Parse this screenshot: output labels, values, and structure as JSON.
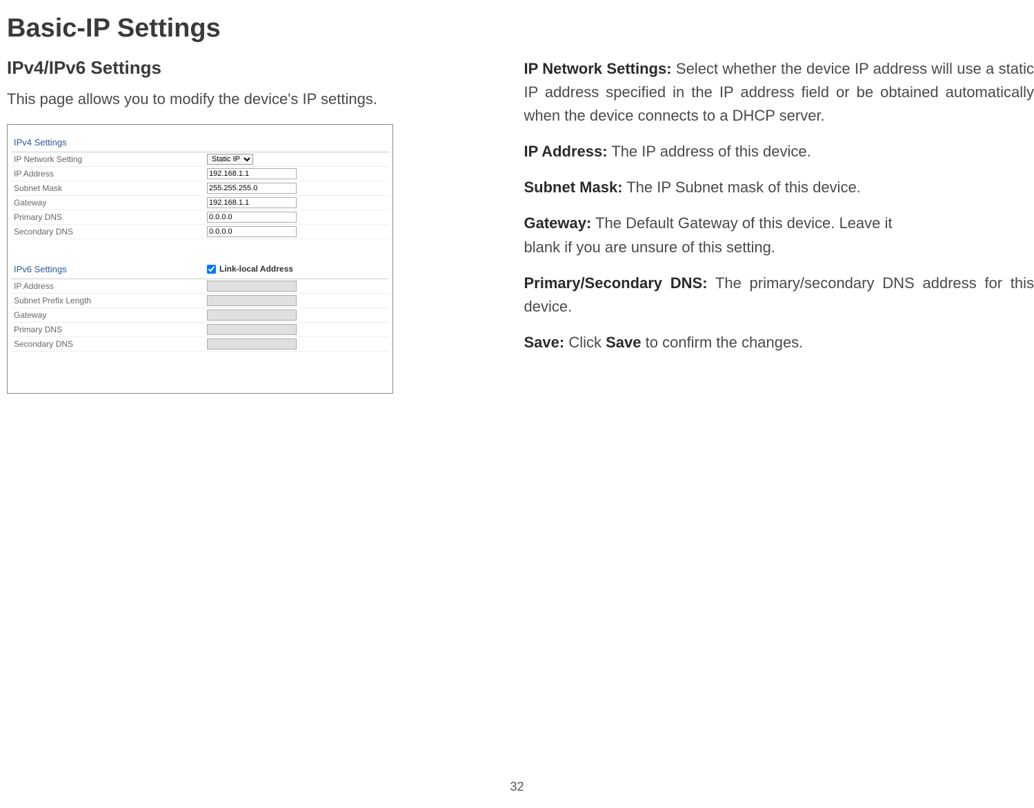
{
  "page_title": "Basic-IP Settings",
  "section_title": "IPv4/IPv6 Settings",
  "intro_text": "This page allows you to modify the device's IP settings.",
  "ipv4": {
    "header": "IPv4 Settings",
    "rows": {
      "ip_network_setting_label": "IP Network Setting",
      "ip_network_setting_value": "Static IP",
      "ip_address_label": "IP Address",
      "ip_address_value": "192.168.1.1",
      "subnet_mask_label": "Subnet Mask",
      "subnet_mask_value": "255.255.255.0",
      "gateway_label": "Gateway",
      "gateway_value": "192.168.1.1",
      "primary_dns_label": "Primary DNS",
      "primary_dns_value": "0.0.0.0",
      "secondary_dns_label": "Secondary DNS",
      "secondary_dns_value": "0.0.0.0"
    }
  },
  "ipv6": {
    "header": "IPv6 Settings",
    "link_local_label": "Link-local Address",
    "rows": {
      "ip_address_label": "IP Address",
      "subnet_prefix_label": "Subnet Prefix Length",
      "gateway_label": "Gateway",
      "primary_dns_label": "Primary DNS",
      "secondary_dns_label": "Secondary DNS"
    }
  },
  "descriptions": {
    "ip_network_bold": "IP Network Settings:",
    "ip_network_text": " Select whether the device IP address will use a static IP address specified in the IP address field or be obtained automatically when the device connects to a DHCP server.",
    "ip_address_bold": "IP Address:",
    "ip_address_text": " The IP address of this device.",
    "subnet_bold": "Subnet Mask:",
    "subnet_text": " The IP Subnet mask of this device.",
    "gateway_bold": "Gateway:",
    "gateway_text_l1": " The Default Gateway of this device. Leave it",
    "gateway_text_l2": "blank if you are unsure of this setting.",
    "dns_bold": "Primary/Secondary DNS:",
    "dns_text": " The primary/secondary DNS address for this device.",
    "save_bold": "Save:",
    "save_text_1": " Click ",
    "save_bold2": "Save",
    "save_text_2": " to confirm the changes."
  },
  "page_number": "32"
}
